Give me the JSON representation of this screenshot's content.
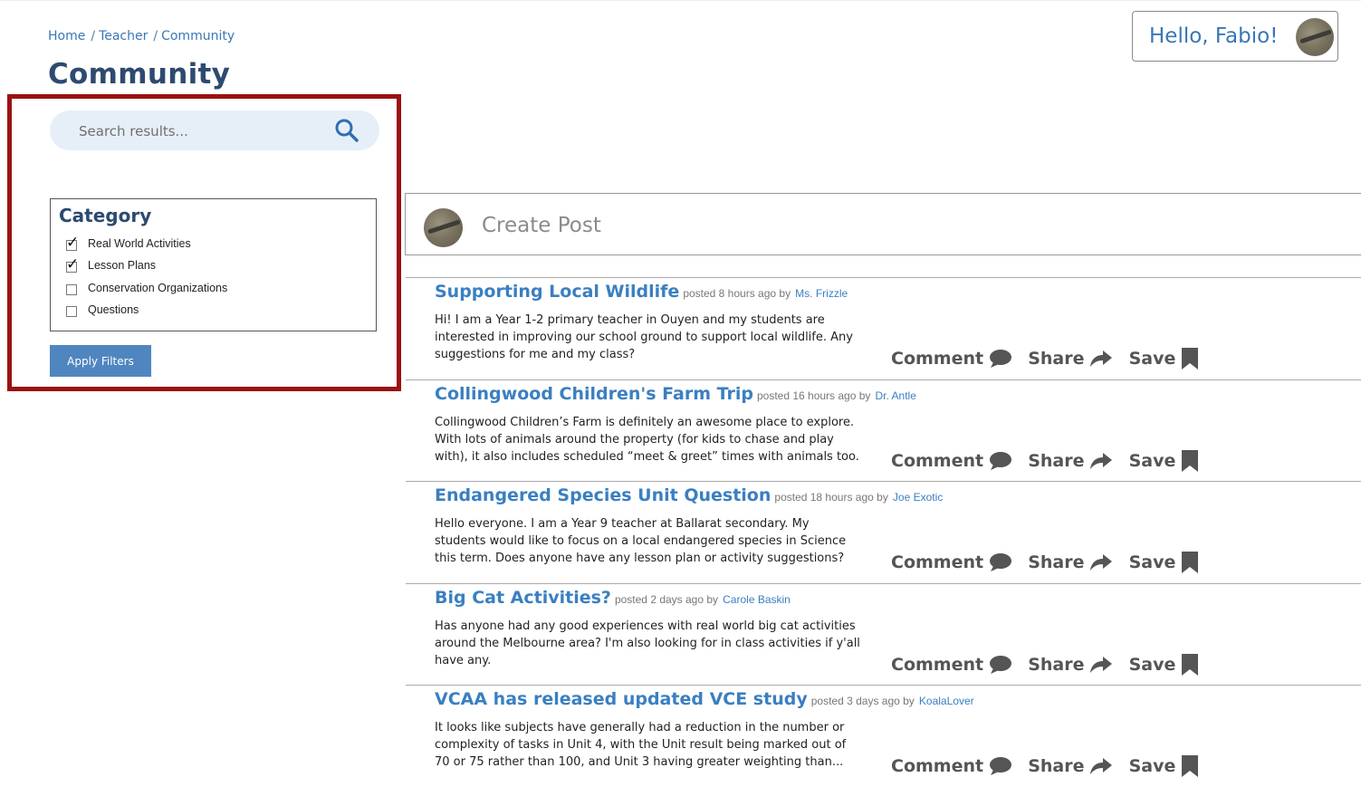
{
  "breadcrumb": {
    "home": "Home",
    "teacher": "Teacher",
    "community": "Community",
    "separator": "/"
  },
  "page_title": "Community",
  "user": {
    "greeting": "Hello, Fabio!",
    "avatar_icon": "avatar"
  },
  "search": {
    "placeholder": "Search results...",
    "icon": "search-icon"
  },
  "filters": {
    "heading": "Category",
    "items": [
      {
        "label": "Real World Activities",
        "checked": true
      },
      {
        "label": "Lesson Plans",
        "checked": true
      },
      {
        "label": "Conservation Organizations",
        "checked": false
      },
      {
        "label": "Questions",
        "checked": false
      }
    ],
    "apply_label": "Apply Filters"
  },
  "create_post": {
    "label": "Create Post"
  },
  "actions": {
    "comment": "Comment",
    "share": "Share",
    "save": "Save"
  },
  "posts": [
    {
      "title": "Supporting Local Wildlife",
      "meta": "posted 8 hours ago by",
      "author": "Ms. Frizzle",
      "body": "Hi! I am a Year 1-2 primary teacher in Ouyen and my students are interested in improving our school ground to support local wildlife. Any suggestions for me and my class?"
    },
    {
      "title": "Collingwood Children's Farm Trip",
      "meta": "posted 16 hours ago by",
      "author": "Dr. Antle",
      "body": "Collingwood Children’s Farm is definitely an awesome place to explore. With lots of animals around the property (for kids to chase and play with), it also includes scheduled “meet & greet” times with animals too."
    },
    {
      "title": "Endangered Species Unit Question",
      "meta": "posted 18 hours ago by",
      "author": "Joe Exotic",
      "body": "Hello everyone. I am a Year 9 teacher at Ballarat secondary. My students would like to focus on a local endangered species in Science this term. Does anyone have any lesson plan or activity suggestions?"
    },
    {
      "title": "Big Cat Activities?",
      "meta": "posted 2 days ago by",
      "author": "Carole Baskin",
      "body": "Has anyone had any good experiences with real world big cat activities around the Melbourne area? I'm also looking for in class activities if y'all have any."
    },
    {
      "title": "VCAA has released updated VCE study",
      "meta": "posted 3 days ago by",
      "author": "KoalaLover",
      "body": "It looks like subjects have generally had a reduction in the number or complexity of tasks in Unit 4, with the Unit result being marked out of 70 or 75 rather than 100, and Unit 3 having greater weighting than..."
    }
  ],
  "colors": {
    "accent": "#3a7fc1",
    "title": "#2d4a70",
    "highlight_border": "#9a1212",
    "button": "#4f86c0",
    "search_bg": "#e6eff8"
  }
}
